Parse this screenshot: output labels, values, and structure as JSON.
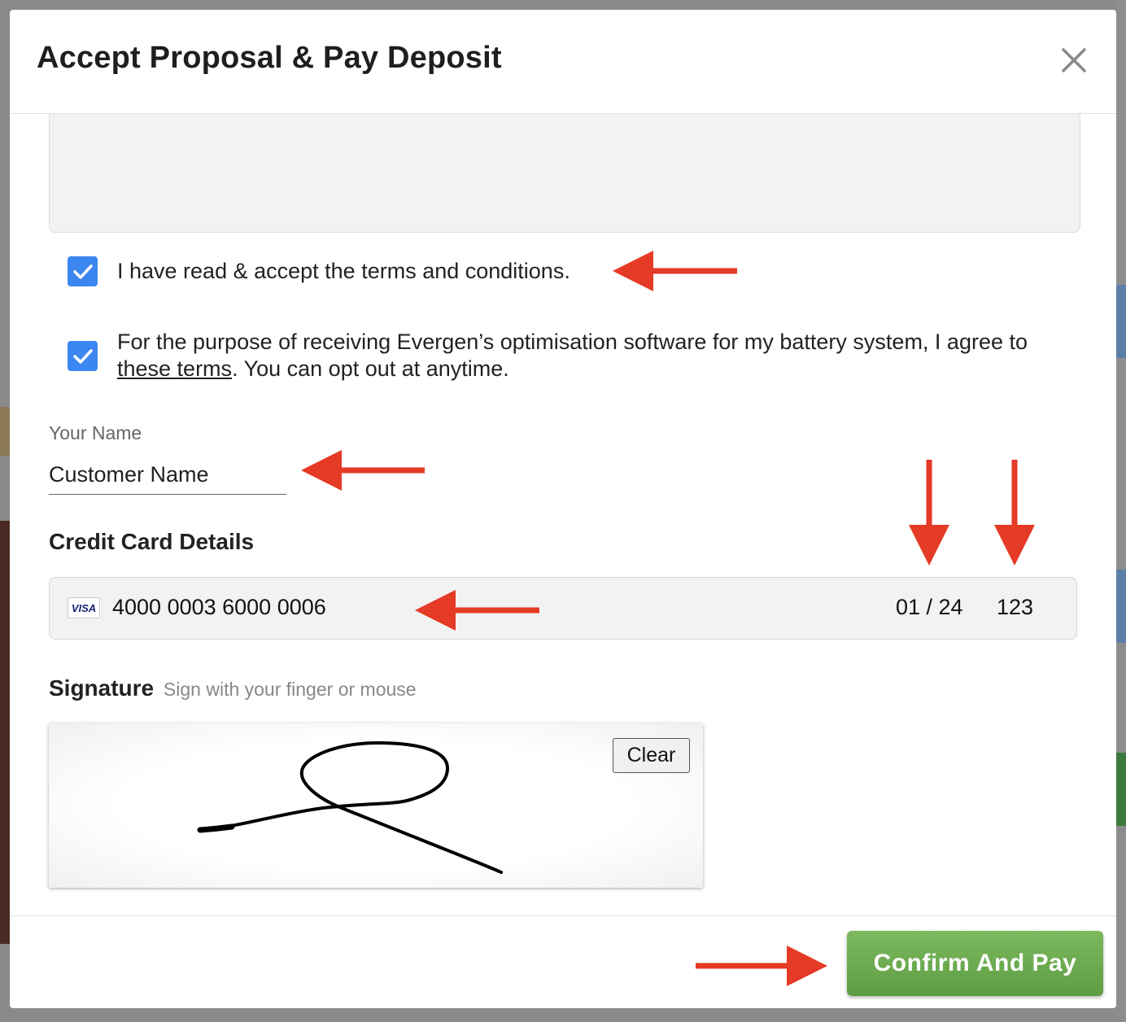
{
  "modal": {
    "title": "Accept Proposal & Pay Deposit"
  },
  "terms": {
    "checkbox1_checked": true,
    "checkbox1_label": "I have read & accept the terms and conditions.",
    "checkbox2_checked": true,
    "checkbox2_text_before": "For the purpose of receiving Evergen’s optimisation software for my battery system, I agree to",
    "checkbox2_link": "these terms",
    "checkbox2_text_after": ". You can opt out at anytime."
  },
  "name": {
    "label": "Your Name",
    "value": "Customer Name"
  },
  "credit_card": {
    "title": "Credit Card Details",
    "brand": "VISA",
    "number": "4000 0003 6000 0006",
    "expiry": "01 / 24",
    "cvc": "123"
  },
  "signature": {
    "title": "Signature",
    "hint": "Sign with your finger or mouse",
    "clear_label": "Clear"
  },
  "footer": {
    "confirm_label": "Confirm And Pay"
  },
  "colors": {
    "checkbox": "#3b86f0",
    "confirm_button": "#6aa84f",
    "annotation_arrow": "#e53a25"
  },
  "icons": [
    "close-icon",
    "checkmark-icon",
    "visa-icon",
    "annotation-arrow-icon"
  ]
}
